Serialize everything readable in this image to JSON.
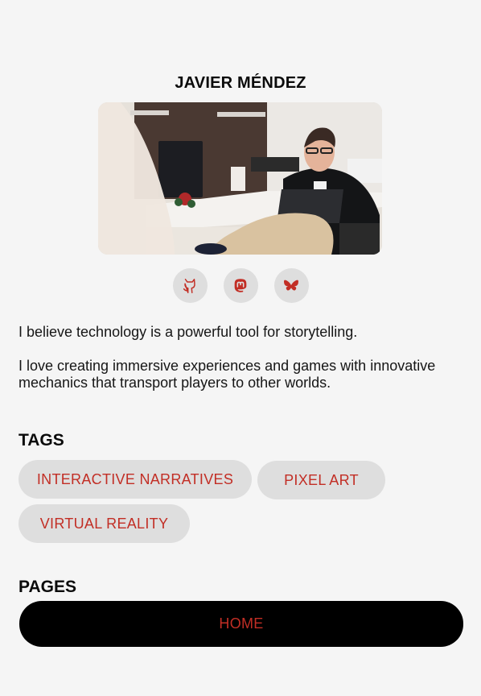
{
  "profile": {
    "name": "JAVIER MÉNDEZ"
  },
  "socials": [
    {
      "icon": "github-icon"
    },
    {
      "icon": "mastodon-icon"
    },
    {
      "icon": "bluesky-icon"
    }
  ],
  "bio": {
    "paragraph_1": "I believe technology is a powerful tool for storytelling.",
    "paragraph_2": "I love creating immersive experiences and games with innovative mechanics that transport players to other worlds."
  },
  "tags": {
    "title": "TAGS",
    "items": [
      "INTERACTIVE NARRATIVES",
      "PIXEL ART",
      "VIRTUAL REALITY"
    ]
  },
  "pages": {
    "title": "PAGES",
    "items": [
      "HOME"
    ]
  },
  "colors": {
    "accent": "#c22e25",
    "background": "#f5f5f5",
    "chip": "#dedede",
    "button": "#000000"
  }
}
